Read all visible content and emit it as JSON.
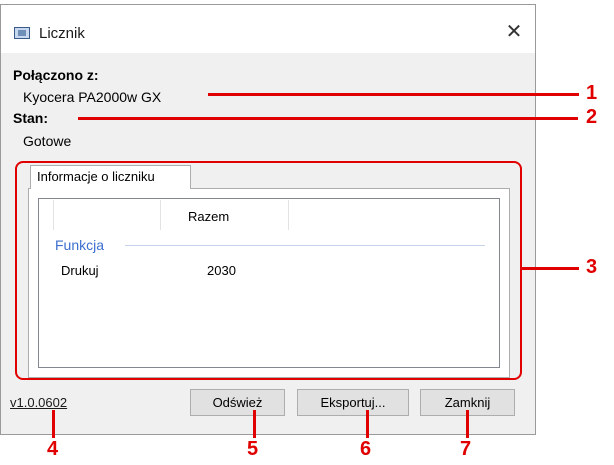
{
  "window": {
    "title": "Licznik",
    "icon": "counter-app-icon",
    "close_glyph": "✕"
  },
  "connection": {
    "connected_label": "Połączono z:",
    "connected_value": "Kyocera PA2000w GX",
    "status_label": "Stan:",
    "status_value": "Gotowe"
  },
  "tab": {
    "label": "Informacje o liczniku"
  },
  "table": {
    "column_header": "Razem",
    "group": "Funkcja",
    "rows": [
      {
        "name": "Drukuj",
        "total": "2030"
      }
    ]
  },
  "footer": {
    "version": "v1.0.0602",
    "refresh_label": "Odśwież",
    "export_label": "Eksportuj...",
    "close_label": "Zamknij"
  },
  "callouts": [
    "1",
    "2",
    "3",
    "4",
    "5",
    "6",
    "7"
  ],
  "colors": {
    "annotation": "#e00000",
    "group_label": "#3c6fcf"
  }
}
